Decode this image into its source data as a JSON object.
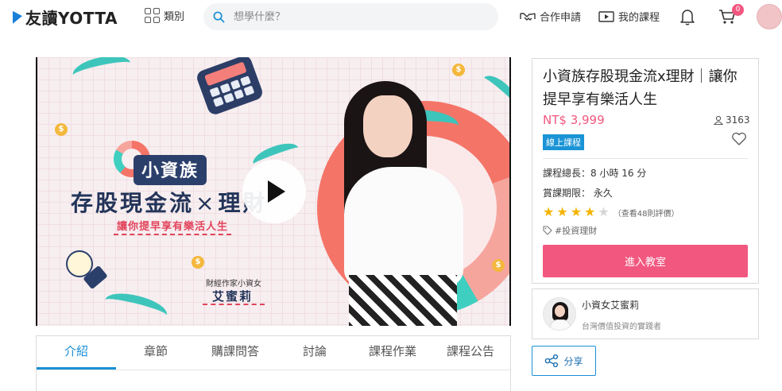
{
  "nav": {
    "logo_text": "友讀YOTTA",
    "category_label": "類別",
    "search_placeholder": "想學什麼？",
    "partner_label": "合作申請",
    "my_courses_label": "我的課程",
    "cart_count": "0",
    "icons": [
      "play-logo-icon",
      "grid-icon",
      "search-icon",
      "handshake-icon",
      "video-course-icon",
      "bell-icon",
      "cart-icon"
    ]
  },
  "video": {
    "tag": "小資族",
    "title_left": "存股現金流",
    "title_x": "×",
    "title_right": "理財",
    "subtitle": "讓你提早享有樂活人生",
    "author_role": "財經作家小資女",
    "author_name": "艾蜜莉",
    "coin_symbol": "$"
  },
  "tabs": [
    {
      "label": "介紹",
      "active": true
    },
    {
      "label": "章節",
      "active": false
    },
    {
      "label": "購課問答",
      "active": false
    },
    {
      "label": "討論",
      "active": false
    },
    {
      "label": "課程作業",
      "active": false
    },
    {
      "label": "課程公告",
      "active": false
    }
  ],
  "course": {
    "title": "小資族存股現金流x理財｜讓你提早享有樂活人生",
    "price": "NT$ 3,999",
    "students": "3163",
    "badge": "線上課程",
    "duration": "課程總長：8 小時 16 分",
    "validity": "賞課期限： 永久",
    "rating_stars": 4,
    "rating_max": 5,
    "reviews": "（查看48則評價）",
    "hashtag": "#投資理財",
    "enter_button": "進入教室"
  },
  "author": {
    "name": "小資女艾蜜莉",
    "description": "台灣價值投資的實踐者"
  },
  "share": {
    "label": "分享"
  },
  "colors": {
    "accent_pink": "#f2577f",
    "accent_blue": "#1a8fd6",
    "badge_blue": "#1a94d6",
    "star_gold": "#f4b400",
    "star_empty": "#d6d6d6"
  }
}
